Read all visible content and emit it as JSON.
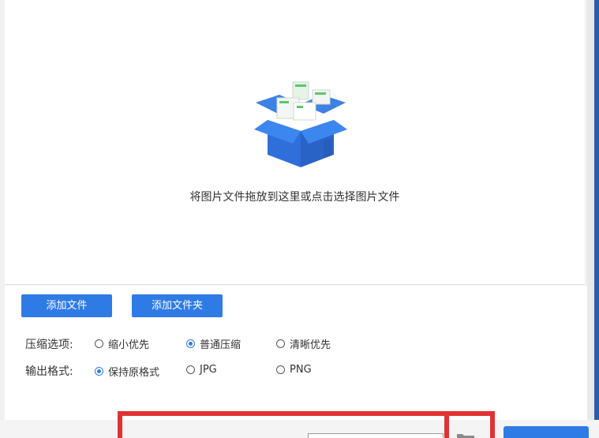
{
  "drop_zone": {
    "hint": "将图片文件拖放到这里或点击选择图片文件",
    "illustration": "open-box-with-images-icon"
  },
  "buttons": {
    "add_file": "添加文件",
    "add_folder": "添加文件夹"
  },
  "compression": {
    "label": "压缩选项:",
    "options": [
      {
        "label": "缩小优先",
        "checked": false
      },
      {
        "label": "普通压缩",
        "checked": true
      },
      {
        "label": "清晰优先",
        "checked": false
      }
    ]
  },
  "output_format": {
    "label": "输出格式:",
    "options": [
      {
        "label": "保持原格式",
        "checked": true
      },
      {
        "label": "JPG",
        "checked": false
      },
      {
        "label": "PNG",
        "checked": false
      }
    ]
  },
  "output_path": {
    "icon": "folder-icon"
  },
  "colors": {
    "accent": "#2f7be6",
    "highlight": "#e03232"
  }
}
